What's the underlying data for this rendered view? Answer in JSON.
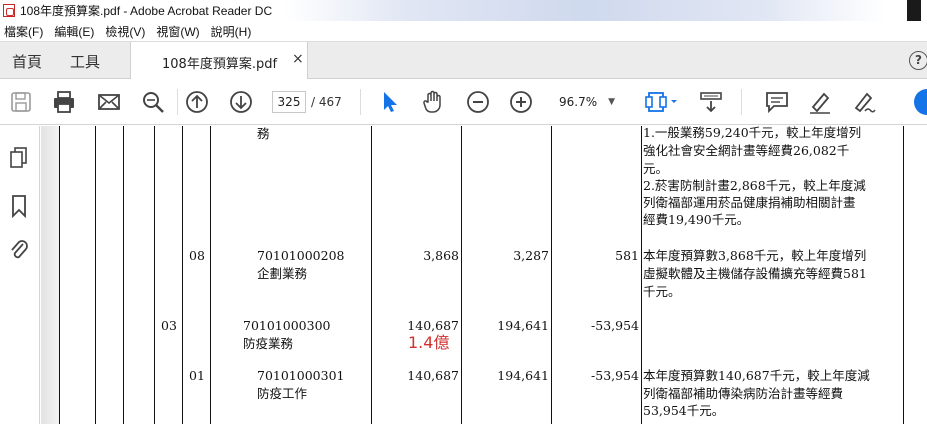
{
  "window": {
    "title": "108年度預算案.pdf - Adobe Acrobat Reader DC"
  },
  "menu": [
    "檔案(F)",
    "編輯(E)",
    "檢視(V)",
    "視窗(W)",
    "說明(H)"
  ],
  "tabs": {
    "home": "首頁",
    "tools": "工具",
    "document": "108年度預算案.pdf",
    "close": "×",
    "help": "?"
  },
  "toolbar": {
    "page_current": "325",
    "page_total": "/ 467",
    "zoom": "96.7%"
  },
  "icons": {
    "save": "save-icon",
    "print": "print-icon",
    "email": "email-icon",
    "search": "search-icon",
    "page_up": "arrow-up-icon",
    "page_down": "arrow-down-icon",
    "select": "pointer-icon",
    "hand": "hand-icon",
    "zoom_out": "zoom-out-icon",
    "zoom_in": "zoom-in-icon",
    "fit": "fit-page-icon",
    "scroll": "scroll-mode-icon",
    "comment": "comment-icon",
    "highlight": "highlight-pen-icon",
    "sign": "sign-icon",
    "pages_panel": "pages-icon",
    "bookmarks": "bookmark-icon",
    "attachments": "paperclip-icon"
  },
  "colors": {
    "accent": "#1473e6",
    "annotation": "#d03030",
    "acrobat_red": "#d32f2f"
  },
  "document": {
    "rows": [
      {
        "col_a": "",
        "col_b": "",
        "code": "",
        "name": "務",
        "budget": "",
        "prior": "",
        "diff": "",
        "note": [
          "1.一般業務59,240千元，較上年度增列",
          "強化社會安全網計畫等經費26,082千",
          "元。",
          "2.菸害防制計畫2,868千元，較上年度減",
          "列衛福部運用菸品健康捐補助相關計畫",
          "經費19,490千元。"
        ]
      },
      {
        "col_a": "",
        "col_b": "08",
        "code": "70101000208",
        "name": "企劃業務",
        "budget": "3,868",
        "prior": "3,287",
        "diff": "581",
        "note": [
          "本年度預算數3,868千元，較上年度增列",
          "虛擬軟體及主機儲存設備擴充等經費581",
          "千元。"
        ]
      },
      {
        "col_a": "03",
        "col_b": "",
        "code": "70101000300",
        "name": "防疫業務",
        "budget": "140,687",
        "prior": "194,641",
        "diff": "-53,954",
        "note": []
      },
      {
        "col_a": "",
        "col_b": "01",
        "code": "70101000301",
        "name": "防疫工作",
        "budget": "140,687",
        "prior": "194,641",
        "diff": "-53,954",
        "note": [
          "本年度預算數140,687千元，較上年度減",
          "列衛福部補助傳染病防治計畫等經費",
          "53,954千元。"
        ]
      }
    ],
    "annotation": "1.4億"
  }
}
